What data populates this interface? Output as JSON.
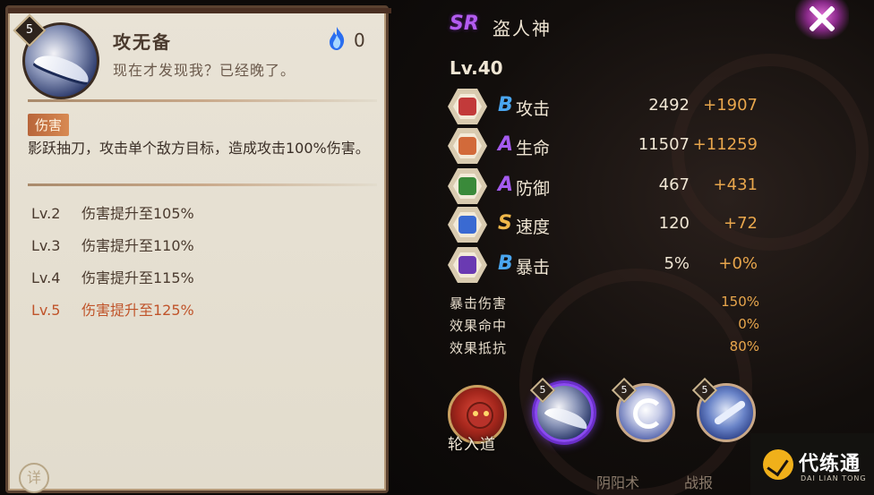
{
  "skill_panel": {
    "level": "5",
    "name": "攻无备",
    "quote": "现在才发现我？已经晚了。",
    "fire_cost": "0",
    "tag": "伤害",
    "description": "影跃抽刀，攻击单个敌方目标，造成攻击100%伤害。",
    "upgrades": [
      {
        "lv": "Lv.2",
        "text": "伤害提升至105%"
      },
      {
        "lv": "Lv.3",
        "text": "伤害提升至110%"
      },
      {
        "lv": "Lv.4",
        "text": "伤害提升至115%"
      },
      {
        "lv": "Lv.5",
        "text": "伤害提升至125%"
      }
    ],
    "detail_button": "详"
  },
  "shikigami": {
    "rarity": "SR",
    "name": "盗人神",
    "level": "Lv.40"
  },
  "stats": [
    {
      "grade": "B",
      "label": "攻击",
      "base": "2492",
      "bonus": "+1907",
      "icon": "attack-icon",
      "icon_color": "#c23a3a"
    },
    {
      "grade": "A",
      "label": "生命",
      "base": "11507",
      "bonus": "+11259",
      "icon": "health-icon",
      "icon_color": "#d26a3a"
    },
    {
      "grade": "A",
      "label": "防御",
      "base": "467",
      "bonus": "+431",
      "icon": "defense-icon",
      "icon_color": "#3a8a3a"
    },
    {
      "grade": "S",
      "label": "速度",
      "base": "120",
      "bonus": "+72",
      "icon": "speed-icon",
      "icon_color": "#3a6ad2"
    },
    {
      "grade": "B",
      "label": "暴击",
      "base": "5%",
      "bonus": "+0%",
      "icon": "crit-icon",
      "icon_color": "#6a3ab2"
    }
  ],
  "sub_stats": [
    {
      "label": "暴击伤害",
      "value": "150%"
    },
    {
      "label": "效果命中",
      "value": "0%"
    },
    {
      "label": "效果抵抗",
      "value": "80%"
    }
  ],
  "skills_bar": {
    "soul_label": "轮入道",
    "skill_levels": [
      "5",
      "5",
      "5"
    ]
  },
  "bottom_tabs": [
    "阴阳术",
    "战报"
  ],
  "watermark": {
    "cn": "代练通",
    "en": "DAI LIAN TONG"
  },
  "colors": {
    "accent_orange": "#e8a64c",
    "grade_b": "#4aa6f0",
    "grade_a": "#a55cf0",
    "grade_s": "#f0b84a"
  }
}
